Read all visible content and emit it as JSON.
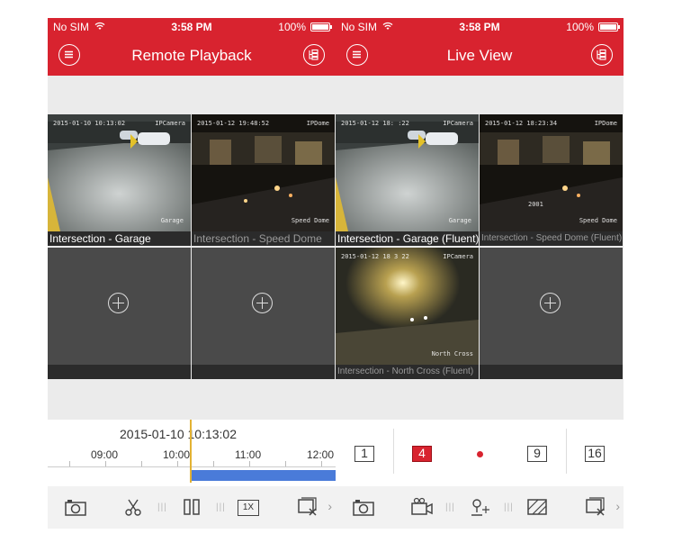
{
  "colors": {
    "brand": "#d8232f",
    "selection": "#e3b233",
    "recording": "#4a7bd9"
  },
  "left": {
    "status": {
      "carrier": "No SIM",
      "time": "3:58 PM",
      "battery": "100%"
    },
    "title": "Remote Playback",
    "tiles": [
      {
        "caption": "Intersection - Garage",
        "osd_time": "2015-01-10 10:13:02",
        "osd_name": "Garage",
        "osd_brand": "IPCamera"
      },
      {
        "caption": "Intersection - Speed Dome",
        "osd_time": "2015-01-12 19:48:52",
        "osd_name": "Speed Dome",
        "osd_brand": "IPDome"
      }
    ],
    "timeline": {
      "datetime": "2015-01-10  10:13:02",
      "ticks": [
        "09:00",
        "10:00",
        "11:00",
        "12:00"
      ]
    },
    "toolbar": [
      "camera-icon",
      "scissors-icon",
      "pause-icon",
      "speed-icon",
      "close-window-icon"
    ],
    "speed_label": "1X"
  },
  "right": {
    "status": {
      "carrier": "No SIM",
      "time": "3:58 PM",
      "battery": "100%"
    },
    "title": "Live View",
    "tiles": [
      {
        "caption": "Intersection - Garage (Fluent)",
        "osd_time": "2015-01-12 18:  :22",
        "osd_name": "Garage",
        "osd_brand": "IPCamera"
      },
      {
        "caption": "Intersection - Speed Dome (Fluent)",
        "osd_time": "2015-01-12 18:23:34",
        "osd_name": "Speed Dome",
        "osd_brand": "IPDome",
        "osd_extra": "2001"
      },
      {
        "caption": "Intersection - North Cross (Fluent)",
        "osd_time": "2015-01-12 18 3 22",
        "osd_name": "North Cross",
        "osd_brand": "IPCamera"
      }
    ],
    "layouts": [
      "1",
      "4",
      "9",
      "16"
    ],
    "toolbar": [
      "camera-icon",
      "record-icon",
      "ptz-icon",
      "image-quality-icon",
      "close-window-icon"
    ]
  }
}
